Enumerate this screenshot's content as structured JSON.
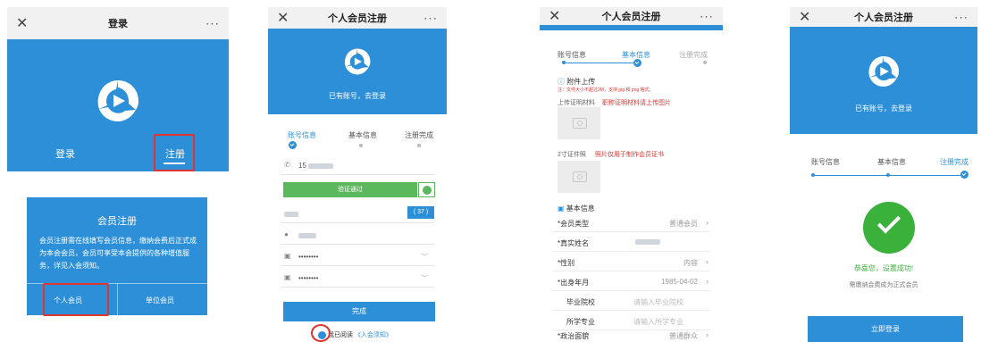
{
  "panel1": {
    "title": "登录",
    "close": "✕",
    "more": "···",
    "tab_login": "登录",
    "tab_register": "注册",
    "dialog_title": "会员注册",
    "dialog_text": "会员注册需在线填写会员信息，缴纳会费后正式成为本会会员，会员可享受本会提供的各种增值服务，详见入会须知。",
    "btn_personal": "个人会员",
    "btn_unit": "单位会员"
  },
  "panel2": {
    "title": "个人会员注册",
    "close": "✕",
    "more": "···",
    "has_account": "已有账号，去登录",
    "steps": [
      "账号信息",
      "基本信息",
      "注册完成"
    ],
    "phone": "15",
    "verify_label": "验证通过",
    "countdown": "( 37 )",
    "password_mask_1": "••••••••",
    "password_mask_2": "••••••••",
    "submit": "完成",
    "agree_prefix": "我已阅读",
    "agree_link": "《入会须知》"
  },
  "panel3": {
    "title": "个人会员注册",
    "close": "✕",
    "more": "···",
    "steps": [
      "账号信息",
      "基本信息",
      "注册完成"
    ],
    "attach_heading": "附件上传",
    "attach_note": "注：文件大小不超过2M，支持 jpg 和 png 格式；",
    "upload1_label": "上传证明材料",
    "upload1_hint": "职称证明材料请上传图片",
    "upload2_label": "2寸证件照",
    "upload2_hint": "照片仅用于制作会员证书",
    "basic_heading": "基本信息",
    "rows": [
      {
        "label": "*会员类型",
        "value": "普通会员"
      },
      {
        "label": "*真实姓名",
        "value": ""
      },
      {
        "label": "*性别",
        "value": "内容"
      },
      {
        "label": "*出身年月",
        "value": "1985-04-02"
      },
      {
        "label": "毕业院校",
        "value": "请输入毕业院校"
      },
      {
        "label": "所学专业",
        "value": "请输入所学专业"
      },
      {
        "label": "*政治面貌",
        "value": "普通群众"
      }
    ]
  },
  "panel4": {
    "title": "个人会员注册",
    "close": "✕",
    "more": "···",
    "has_account": "已有账号，去登录",
    "steps": [
      "账号信息",
      "基本信息",
      "注册完成"
    ],
    "success": "恭喜您，设置成功!",
    "sub": "需缴纳会费成为正式会员",
    "login_btn": "立即登录"
  },
  "colors": {
    "brand_blue": "#2d8fd8",
    "success_green": "#3ab13a",
    "highlight_red": "#e0342f"
  }
}
